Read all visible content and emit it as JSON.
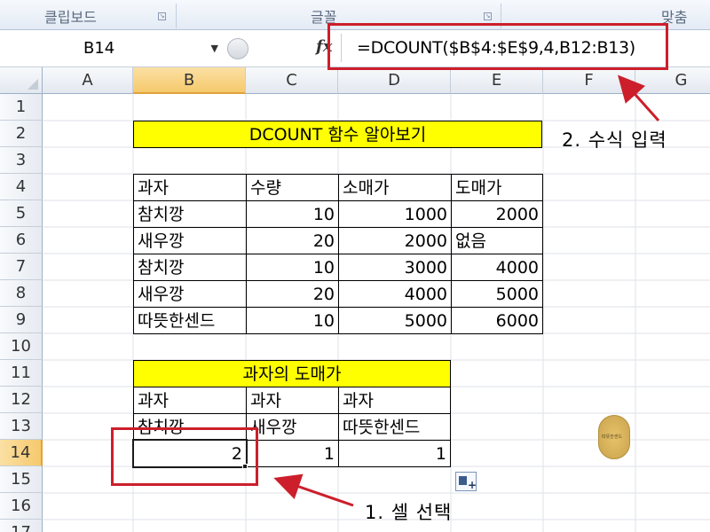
{
  "ribbon": {
    "groups": [
      "클립보드",
      "글꼴",
      "맞춤"
    ]
  },
  "formula_bar": {
    "name_box": "B14",
    "fx_label": "fx",
    "formula": "=DCOUNT($B$4:$E$9,4,B12:B13)"
  },
  "grid": {
    "columns": [
      "A",
      "B",
      "C",
      "D",
      "E",
      "F",
      "G"
    ],
    "rows": [
      "1",
      "2",
      "3",
      "4",
      "5",
      "6",
      "7",
      "8",
      "9",
      "10",
      "11",
      "12",
      "13",
      "14",
      "15",
      "16",
      "17"
    ],
    "selected_column": "B",
    "selected_row": "14"
  },
  "sheet": {
    "title": "DCOUNT 함수 알아보기",
    "table_headers": [
      "과자",
      "수량",
      "소매가",
      "도매가"
    ],
    "table_rows": [
      [
        "참치깡",
        "10",
        "1000",
        "2000"
      ],
      [
        "새우깡",
        "20",
        "2000",
        "없음"
      ],
      [
        "참치깡",
        "10",
        "3000",
        "4000"
      ],
      [
        "새우깡",
        "20",
        "4000",
        "5000"
      ],
      [
        "따뜻한센드",
        "10",
        "5000",
        "6000"
      ]
    ],
    "criteria_title": "과자의 도매가",
    "criteria_headers": [
      "과자",
      "과자",
      "과자"
    ],
    "criteria_values": [
      "참치깡",
      "새우깡",
      "따뜻한센드"
    ],
    "results": [
      "2",
      "1",
      "1"
    ]
  },
  "annotations": {
    "step1": "1. 셀 선택",
    "step2": "2. 수식 입력",
    "highlight_color": "#cc1f2b"
  },
  "icons": [
    "dialog-launcher-icon",
    "dropdown-arrow-icon",
    "fx-icon",
    "paste-options-icon",
    "select-all-icon"
  ],
  "sticker": {
    "text": "따뜻한센드"
  }
}
